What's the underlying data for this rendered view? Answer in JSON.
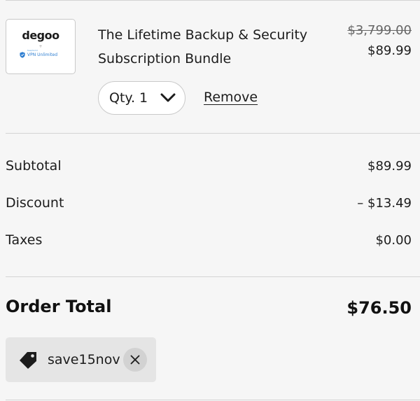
{
  "product": {
    "thumbnail": {
      "brand": "degoo",
      "plus": "+",
      "vpn_small_text": "KeepSolid",
      "vpn_label": "VPN Unlimited",
      "icon": "shield-icon"
    },
    "title": "The Lifetime Backup & Security Subscription Bundle",
    "original_price": "$3,799.00",
    "sale_price": "$89.99",
    "quantity_label": "Qty. 1",
    "remove_label": "Remove"
  },
  "summary": {
    "subtotal_label": "Subtotal",
    "subtotal_value": "$89.99",
    "discount_label": "Discount",
    "discount_value": "– $13.49",
    "taxes_label": "Taxes",
    "taxes_value": "$0.00"
  },
  "order_total": {
    "label": "Order Total",
    "value": "$76.50"
  },
  "promo": {
    "code": "save15nov",
    "tag_icon": "tag-icon",
    "clear_icon": "close-icon"
  },
  "colors": {
    "background": "#f6f6f6",
    "text": "#1c1c1c",
    "divider": "#d4d4d4",
    "chip": "#e5e5e5",
    "vpn_blue": "#2f7fd1"
  }
}
